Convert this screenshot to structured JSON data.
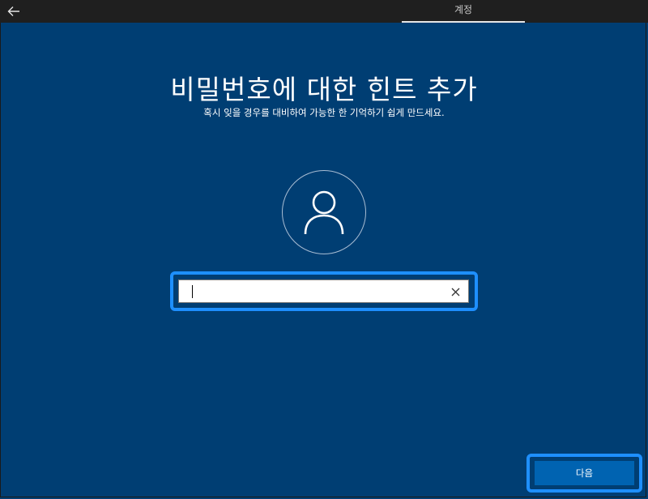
{
  "header": {
    "back_icon": "arrow-left-icon",
    "tab_label": "계정"
  },
  "main": {
    "title": "비밀번호에 대한 힌트 추가",
    "subtitle": "혹시 잊을 경우를 대비하여 가능한 한 기억하기 쉽게 만드세요.",
    "avatar_icon": "user-icon",
    "hint_input": {
      "value": "",
      "clear_icon": "close-icon"
    }
  },
  "footer": {
    "next_label": "다음"
  },
  "colors": {
    "background": "#003e73",
    "topbar": "#1f1f1f",
    "focus_ring": "#1e8fff",
    "button": "#0063b1"
  }
}
